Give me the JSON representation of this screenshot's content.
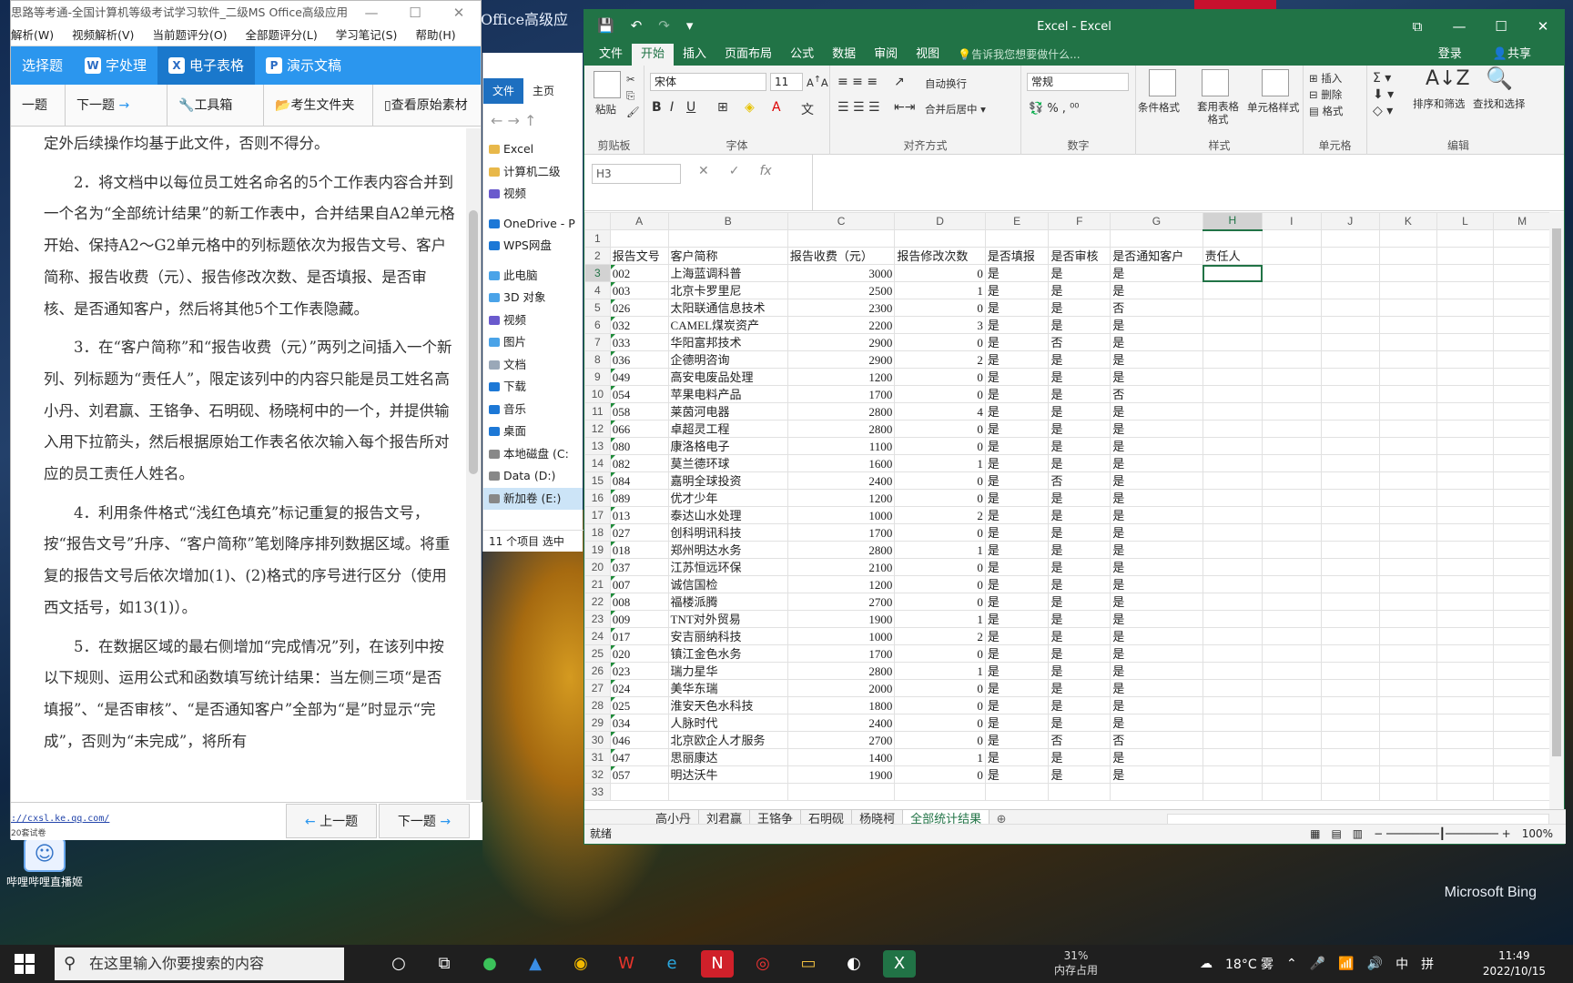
{
  "left_app": {
    "title": "思路等考通-全国计算机等级考试学习软件_二级MS Office高级应用",
    "menu": [
      "解析(W)",
      "视频解析(V)",
      "当前题评分(O)",
      "全部题评分(L)",
      "学习笔记(S)",
      "帮助(H)"
    ],
    "subjects": [
      "选择题",
      "字处理",
      "电子表格",
      "演示文稿"
    ],
    "subject_icons": [
      "W",
      "X",
      "P"
    ],
    "tools": [
      "一题",
      "下一题",
      "工具箱",
      "考生文件夹",
      "查看原始素材"
    ],
    "paragraphs": [
      "定外后续操作均基于此文件，否则不得分。",
      "2．将文档中以每位员工姓名命名的5个工作表内容合并到一个名为“全部统计结果”的新工作表中，合并结果自A2单元格开始、保持A2～G2单元格中的列标题依次为报告文号、客户简称、报告收费（元）、报告修改次数、是否填报、是否审核、是否通知客户，然后将其他5个工作表隐藏。",
      "3．在“客户简称”和“报告收费（元）”两列之间插入一个新列、列标题为“责任人”，限定该列中的内容只能是员工姓名高小丹、刘君赢、王铬争、石明砚、杨晓柯中的一个，并提供输入用下拉箭头，然后根据原始工作表名依次输入每个报告所对应的员工责任人姓名。",
      "4．利用条件格式“浅红色填充”标记重复的报告文号，按“报告文号”升序、“客户简称”笔划降序排列数据区域。将重复的报告文号后依次增加(1)、(2)格式的序号进行区分（使用西文括号，如13(1)）。",
      "5．在数据区域的最右侧增加“完成情况”列，在该列中按以下规则、运用公式和函数填写统计结果：当左侧三项“是否填报”、“是否审核”、“是否通知客户”全部为“是”时显示“完成”，否则为“未完成”，将所有"
    ],
    "url": "://cxsl.ke.qq.com/",
    "note": "20套试卷",
    "prev_btn": "上一题",
    "next_btn": "下一题"
  },
  "desktop": {
    "icon_label": "哔哩哔哩直播姬",
    "bing": "Microsoft Bing",
    "office_label": "Office高级应"
  },
  "explorer": {
    "tabs": [
      "文件",
      "主页"
    ],
    "items": [
      "Excel",
      "计算机二级",
      "视频",
      "OneDrive - P",
      "WPS网盘",
      "此电脑",
      "3D 对象",
      "视频",
      "图片",
      "文档",
      "下载",
      "音乐",
      "桌面",
      "本地磁盘 (C:",
      "Data (D:)",
      "新加卷 (E:)"
    ],
    "status": "11 个项目    选中"
  },
  "excel": {
    "title": "Excel - Excel",
    "tabs": [
      "文件",
      "开始",
      "插入",
      "页面布局",
      "公式",
      "数据",
      "审阅",
      "视图"
    ],
    "tell_me": "告诉我您想要做什么...",
    "login": "登录",
    "share": "共享",
    "ribbon": {
      "paste": "粘贴",
      "clipboard": "剪贴板",
      "font_name": "宋体",
      "font_size": "11",
      "font": "字体",
      "wrap": "自动换行",
      "merge": "合并后居中",
      "align": "对齐方式",
      "numfmt": "常规",
      "number": "数字",
      "cond": "条件格式",
      "table": "套用表格格式",
      "cellstyle": "单元格样式",
      "styles": "样式",
      "insert": "插入",
      "delete": "删除",
      "format": "格式",
      "cells": "单元格",
      "sort": "排序和筛选",
      "find": "查找和选择",
      "edit": "编辑"
    },
    "namebox": "H3",
    "columns": [
      "A",
      "B",
      "C",
      "D",
      "E",
      "F",
      "G",
      "H",
      "I",
      "J",
      "K",
      "L",
      "M"
    ],
    "headers": [
      "报告文号",
      "客户简称",
      "报告收费（元）",
      "报告修改次数",
      "是否填报",
      "是否审核",
      "是否通知客户",
      "责任人"
    ],
    "rows": [
      [
        "002",
        "上海蓝调科普",
        "3000",
        "0",
        "是",
        "是",
        "是"
      ],
      [
        "003",
        "北京卡罗里尼",
        "2500",
        "1",
        "是",
        "是",
        "是"
      ],
      [
        "026",
        "太阳联通信息技术",
        "2300",
        "0",
        "是",
        "是",
        "否"
      ],
      [
        "032",
        "CAMEL煤炭资产",
        "2200",
        "3",
        "是",
        "是",
        "是"
      ],
      [
        "033",
        "华阳富邦技术",
        "2900",
        "0",
        "是",
        "否",
        "是"
      ],
      [
        "036",
        "企德明咨询",
        "2900",
        "2",
        "是",
        "是",
        "是"
      ],
      [
        "049",
        "高安电废品处理",
        "1200",
        "0",
        "是",
        "是",
        "是"
      ],
      [
        "054",
        "苹果电料产品",
        "1700",
        "0",
        "是",
        "是",
        "否"
      ],
      [
        "058",
        "莱茵河电器",
        "2800",
        "4",
        "是",
        "是",
        "是"
      ],
      [
        "066",
        "卓超灵工程",
        "2800",
        "0",
        "是",
        "是",
        "是"
      ],
      [
        "080",
        "康洛格电子",
        "1100",
        "0",
        "是",
        "是",
        "是"
      ],
      [
        "082",
        "莫兰德环球",
        "1600",
        "1",
        "是",
        "是",
        "是"
      ],
      [
        "084",
        "嘉明全球投资",
        "2400",
        "0",
        "是",
        "否",
        "是"
      ],
      [
        "089",
        "优才少年",
        "1200",
        "0",
        "是",
        "是",
        "是"
      ],
      [
        "013",
        "泰达山水处理",
        "1000",
        "2",
        "是",
        "是",
        "是"
      ],
      [
        "027",
        "创科明讯科技",
        "1700",
        "0",
        "是",
        "是",
        "是"
      ],
      [
        "018",
        "郑州明达水务",
        "2800",
        "1",
        "是",
        "是",
        "是"
      ],
      [
        "037",
        "江苏恒远环保",
        "2100",
        "0",
        "是",
        "是",
        "是"
      ],
      [
        "007",
        "诚信国检",
        "1200",
        "0",
        "是",
        "是",
        "是"
      ],
      [
        "008",
        "福楼派腾",
        "2700",
        "0",
        "是",
        "是",
        "是"
      ],
      [
        "009",
        "TNT对外贸易",
        "1900",
        "1",
        "是",
        "是",
        "是"
      ],
      [
        "017",
        "安吉丽纳科技",
        "1000",
        "2",
        "是",
        "是",
        "是"
      ],
      [
        "020",
        "镇江金色水务",
        "1700",
        "0",
        "是",
        "是",
        "是"
      ],
      [
        "023",
        "瑞力星华",
        "2800",
        "1",
        "是",
        "是",
        "是"
      ],
      [
        "024",
        "美华东瑞",
        "2000",
        "0",
        "是",
        "是",
        "是"
      ],
      [
        "025",
        "淮安天色水科技",
        "1800",
        "0",
        "是",
        "是",
        "是"
      ],
      [
        "034",
        "人脉时代",
        "2400",
        "0",
        "是",
        "是",
        "是"
      ],
      [
        "046",
        "北京欧企人才服务",
        "2700",
        "0",
        "是",
        "否",
        "否"
      ],
      [
        "047",
        "思丽康达",
        "1400",
        "1",
        "是",
        "是",
        "是"
      ],
      [
        "057",
        "明达沃牛",
        "1900",
        "0",
        "是",
        "是",
        "是"
      ]
    ],
    "sheets": [
      "高小丹",
      "刘君赢",
      "王铬争",
      "石明砚",
      "杨晓柯",
      "全部统计结果"
    ],
    "status": "就绪",
    "zoom": "100%"
  },
  "taskbar": {
    "search_placeholder": "在这里输入你要搜索的内容",
    "mem_pct": "31%",
    "mem_label": "内存占用",
    "weather": "18°C 雾",
    "ime": "中",
    "ime2": "拼",
    "time": "11:49",
    "date": "2022/10/15"
  }
}
